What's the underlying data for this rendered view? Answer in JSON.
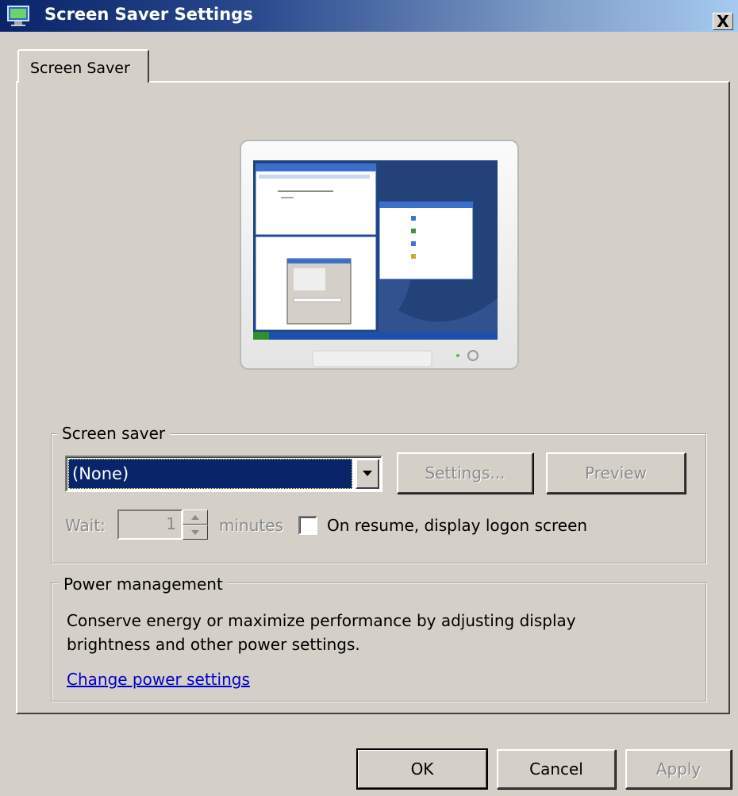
{
  "window": {
    "title": "Screen Saver Settings",
    "close_label": "X"
  },
  "tabs": [
    {
      "label": "Screen Saver",
      "active": true
    }
  ],
  "screen_saver_group": {
    "label": "Screen saver",
    "selected": "(None)",
    "settings_label": "Settings...",
    "preview_label": "Preview",
    "wait_label": "Wait:",
    "wait_value": "1",
    "minutes_label": "minutes",
    "resume_label": "On resume, display logon screen",
    "resume_checked": false
  },
  "power_group": {
    "label": "Power management",
    "description_line1": "Conserve energy or maximize performance by adjusting display",
    "description_line2": "brightness and other power settings.",
    "link_label": "Change power settings"
  },
  "footer": {
    "ok_label": "OK",
    "cancel_label": "Cancel",
    "apply_label": "Apply"
  },
  "colors": {
    "dialog_bg": "#d4d0c8",
    "title_bar_start": "#0a246a",
    "title_bar_end": "#a6caf0",
    "selection": "#0a246a",
    "link": "#0000cc",
    "disabled_text": "#8a8a8a"
  }
}
